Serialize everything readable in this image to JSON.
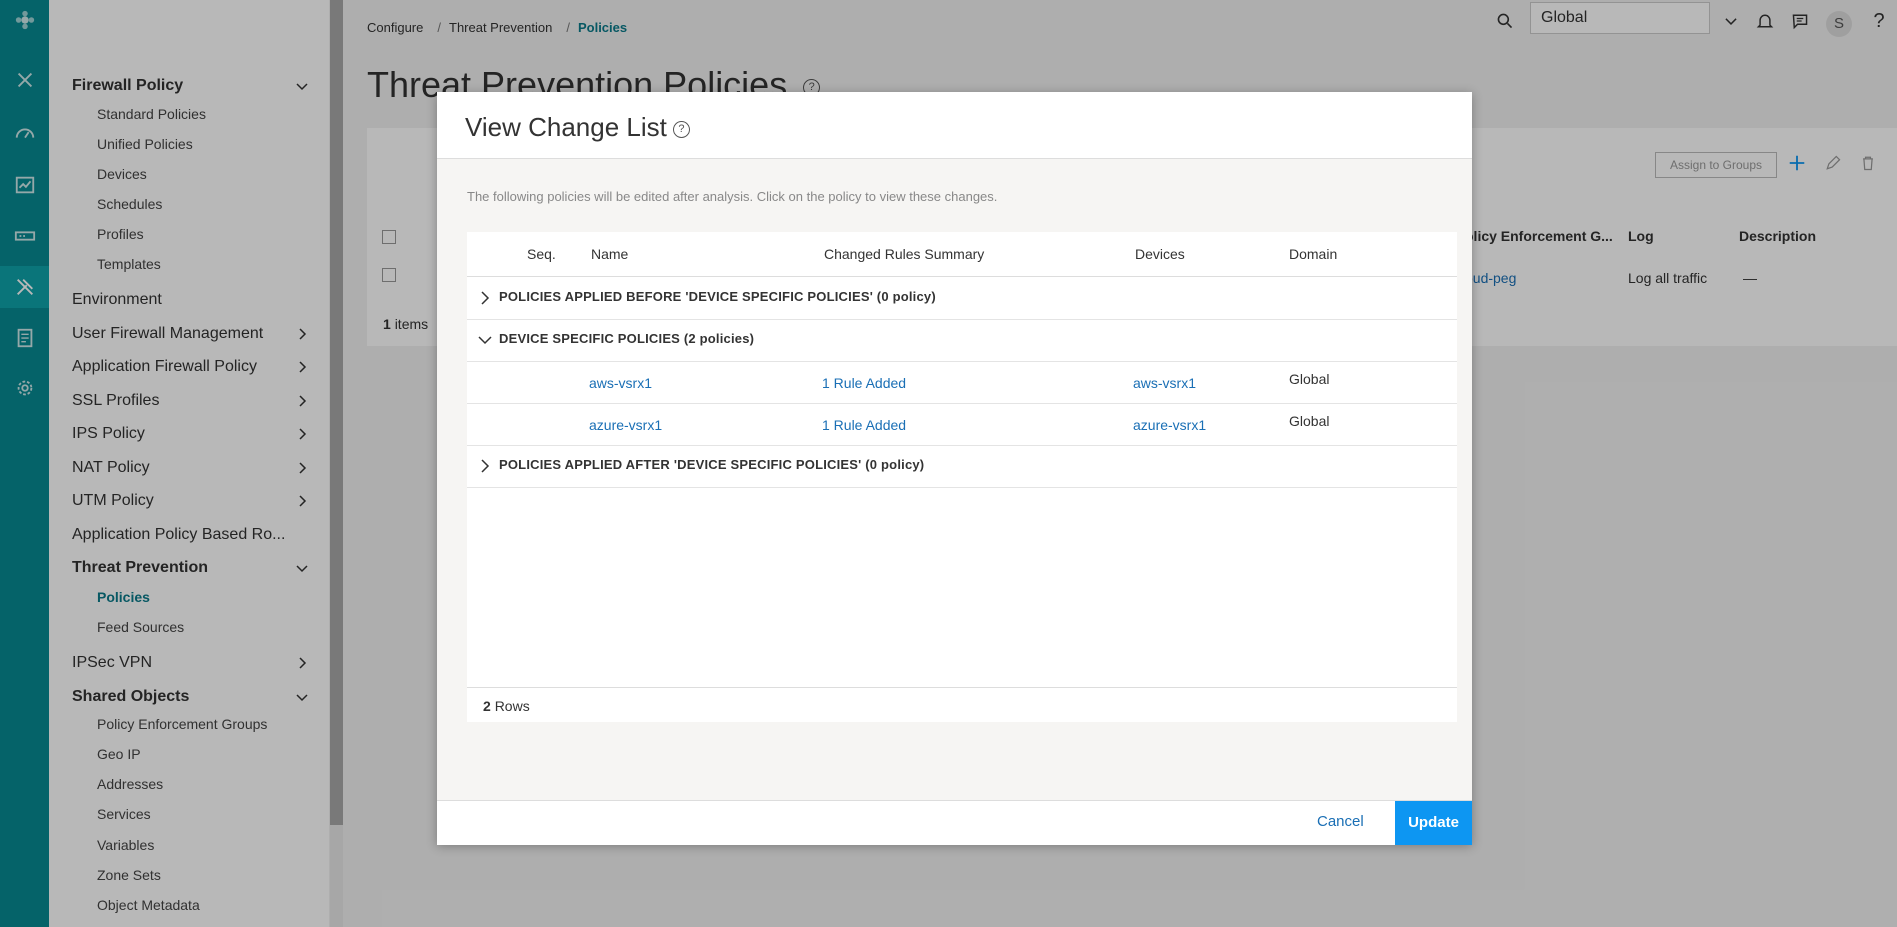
{
  "breadcrumb": [
    "Configure",
    "Threat Prevention",
    "Policies"
  ],
  "page_title": "Threat Prevention Policies",
  "header": {
    "domain_select": "Global",
    "avatar_initial": "S"
  },
  "sidebar": {
    "firewall_policy": "Firewall Policy",
    "firewall_items": [
      "Standard Policies",
      "Unified Policies",
      "Devices",
      "Schedules",
      "Profiles",
      "Templates"
    ],
    "environment": "Environment",
    "user_firewall": "User Firewall Management",
    "app_firewall": "Application Firewall Policy",
    "ssl_profiles": "SSL Profiles",
    "ips_policy": "IPS Policy",
    "nat_policy": "NAT Policy",
    "utm_policy": "UTM Policy",
    "app_policy_routing": "Application Policy Based Ro...",
    "threat_prevention": "Threat Prevention",
    "threat_items": [
      "Policies",
      "Feed Sources"
    ],
    "ipsec_vpn": "IPSec VPN",
    "shared_objects": "Shared Objects",
    "shared_items": [
      "Policy Enforcement Groups",
      "Geo IP",
      "Addresses",
      "Services",
      "Variables",
      "Zone Sets",
      "Object Metadata"
    ]
  },
  "background": {
    "assign_button": "Assign to Groups",
    "columns": [
      "olicy Enforcement G...",
      "Log",
      "Description"
    ],
    "row": {
      "peg": "oud-peg",
      "log": "Log all traffic",
      "description": "—"
    },
    "items_count": "1",
    "items_label": "items"
  },
  "modal": {
    "title": "View Change List",
    "description": "The following policies will be edited after analysis. Click on the policy to view these changes.",
    "columns": {
      "seq": "Seq.",
      "name": "Name",
      "summary": "Changed Rules Summary",
      "devices": "Devices",
      "domain": "Domain"
    },
    "groups": [
      {
        "label": "POLICIES APPLIED BEFORE 'DEVICE SPECIFIC POLICIES' (0 policy)"
      },
      {
        "label": "DEVICE SPECIFIC POLICIES (2 policies)"
      },
      {
        "label": "POLICIES APPLIED AFTER 'DEVICE SPECIFIC POLICIES' (0 policy)"
      }
    ],
    "rows": [
      {
        "name": "aws-vsrx1",
        "summary": "1 Rule Added",
        "device": "aws-vsrx1",
        "domain": "Global"
      },
      {
        "name": "azure-vsrx1",
        "summary": "1 Rule Added",
        "device": "azure-vsrx1",
        "domain": "Global"
      }
    ],
    "row_count": "2",
    "row_count_label": "Rows",
    "cancel": "Cancel",
    "update": "Update"
  },
  "colors": {
    "rail": "#088a92",
    "accent": "#0d96f2",
    "link": "#1a6fb5",
    "active_nav": "#0b7a8a"
  }
}
